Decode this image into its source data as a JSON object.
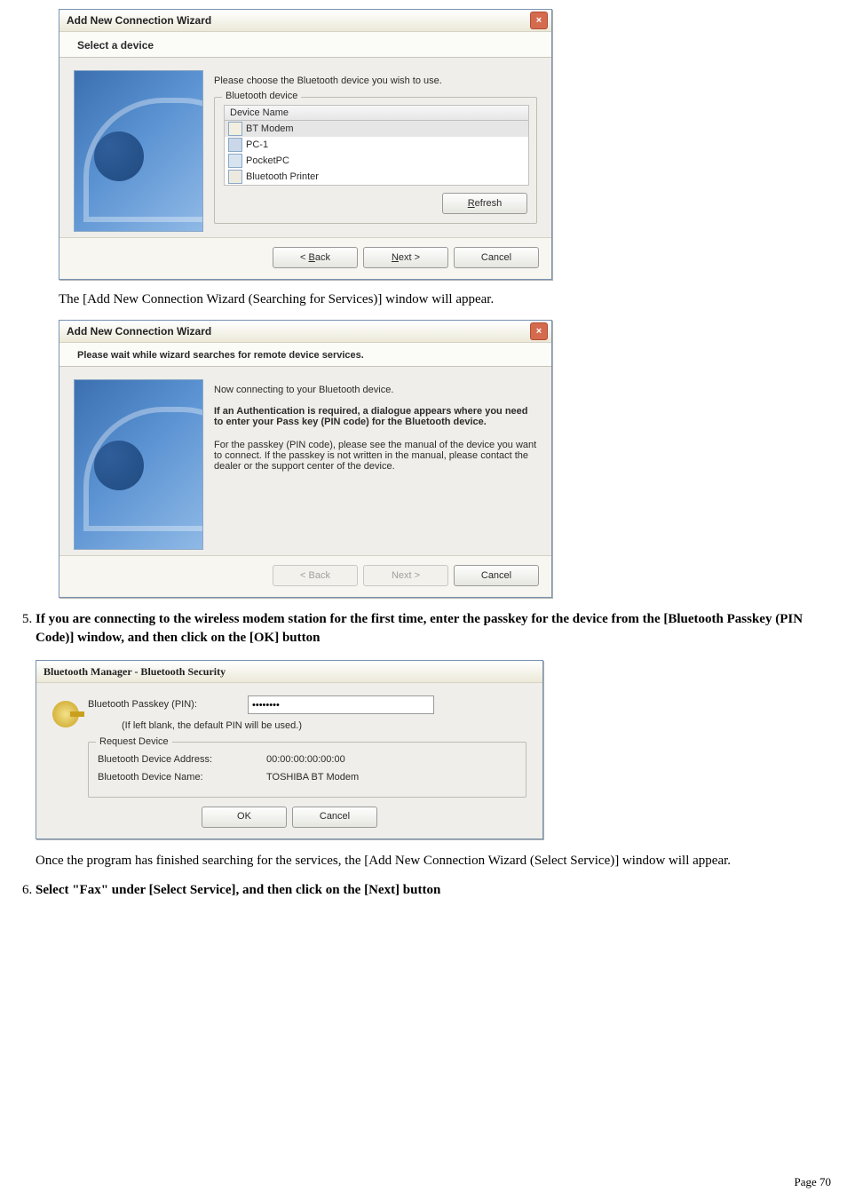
{
  "dialog1": {
    "title": "Add New Connection Wizard",
    "header": "Select a device",
    "instruction": "Please choose the Bluetooth device you wish to use.",
    "group_label": "Bluetooth device",
    "column": "Device Name",
    "devices": [
      "BT Modem",
      "PC-1",
      "PocketPC",
      "Bluetooth Printer"
    ],
    "refresh": "Refresh",
    "back": "Back",
    "next": "Next >",
    "cancel": "Cancel"
  },
  "para1": "The [Add New Connection Wizard (Searching for Services)] window will appear.",
  "dialog2": {
    "title": "Add New Connection Wizard",
    "header": "Please wait while wizard searches for remote device services.",
    "line1": "Now connecting to your Bluetooth device.",
    "bold1": "If an Authentication is required, a dialogue appears where you need to enter your Pass key (PIN code) for the Bluetooth device.",
    "line2": "For the passkey (PIN code), please see the manual of the device you want to connect. If the passkey is not written in the manual, please contact the dealer or the support center of the device.",
    "back": "< Back",
    "next": "Next >",
    "cancel": "Cancel"
  },
  "step5": "If you are connecting to the wireless modem station for the first time, enter the passkey for the device from the [Bluetooth Passkey (PIN Code)] window, and then click on the [OK] button",
  "dialog3": {
    "title": "Bluetooth Manager - Bluetooth Security",
    "passkey_label": "Bluetooth Passkey (PIN):",
    "passkey_value": "••••••••",
    "hint": "(If left blank, the default PIN will be used.)",
    "group": "Request Device",
    "addr_label": "Bluetooth Device Address:",
    "addr_value": "00:00:00:00:00:00",
    "name_label": "Bluetooth Device Name:",
    "name_value": "TOSHIBA BT Modem",
    "ok": "OK",
    "cancel": "Cancel"
  },
  "para2": "Once the program has finished searching for the services, the [Add New Connection Wizard (Select Service)] window will appear.",
  "step6": "Select \"Fax\" under [Select Service], and then click on the [Next] button",
  "footer": "Page 70"
}
